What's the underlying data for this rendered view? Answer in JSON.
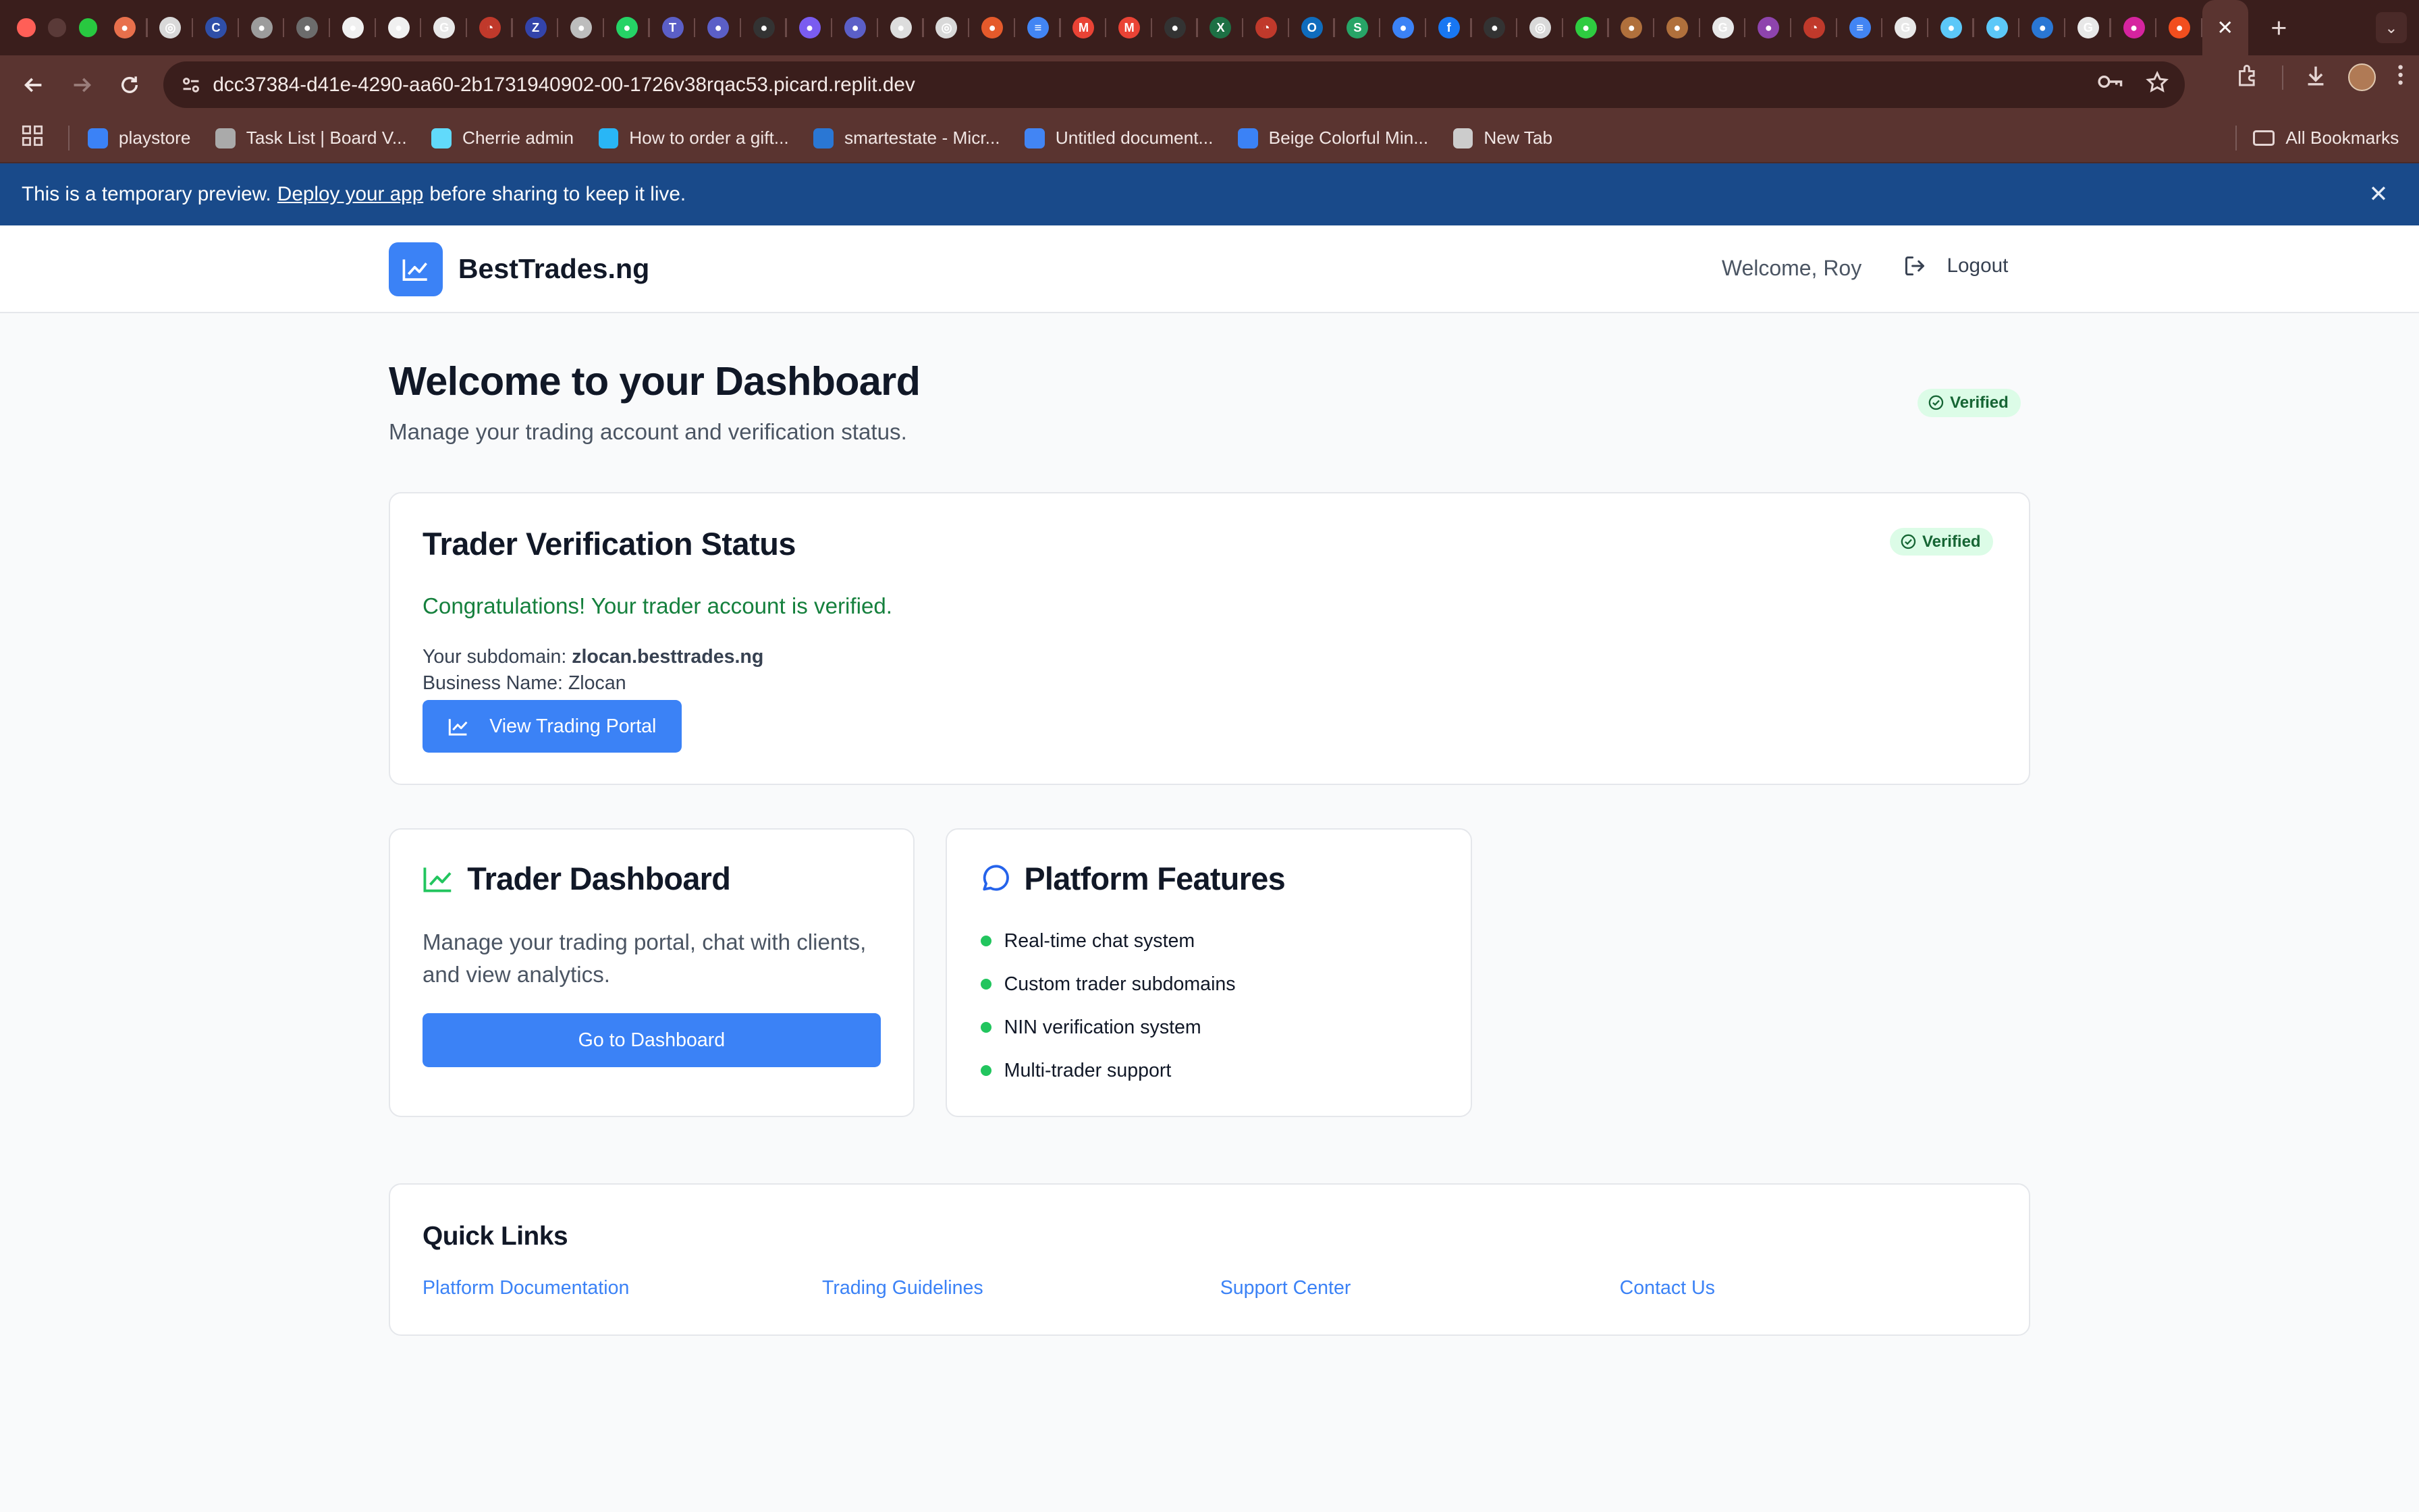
{
  "browser": {
    "url": "dcc37384-d41e-4290-aa60-2b1731940902-00-1726v38rqac53.picard.replit.dev",
    "tab_favicons": [
      {
        "icon": "chrome-icon",
        "color": "#e8704c",
        "glyph": "●"
      },
      {
        "icon": "openai-icon",
        "color": "#d9d9d9",
        "glyph": "◎"
      },
      {
        "icon": "c-icon",
        "color": "#2f4fa8",
        "glyph": "C"
      },
      {
        "icon": "apple-icon",
        "color": "#9c9c9c",
        "glyph": "●"
      },
      {
        "icon": "apple-icon",
        "color": "#6c6c6c",
        "glyph": "●"
      },
      {
        "icon": "github-icon",
        "color": "#f0f0f0",
        "glyph": "●"
      },
      {
        "icon": "github-icon",
        "color": "#f0f0f0",
        "glyph": "●"
      },
      {
        "icon": "google-icon",
        "color": "#e8e8e8",
        "glyph": "G"
      },
      {
        "icon": "speed-icon",
        "color": "#c0392b",
        "glyph": "◔"
      },
      {
        "icon": "z-icon",
        "color": "#3344aa",
        "glyph": "Z"
      },
      {
        "icon": "circle-icon",
        "color": "#bdbdbd",
        "glyph": "●"
      },
      {
        "icon": "whatsapp-icon",
        "color": "#25d366",
        "glyph": "●"
      },
      {
        "icon": "teams-icon",
        "color": "#5b5fc7",
        "glyph": "T"
      },
      {
        "icon": "chat-icon",
        "color": "#5b5fc7",
        "glyph": "●"
      },
      {
        "icon": "3600-icon",
        "color": "#333333",
        "glyph": "●"
      },
      {
        "icon": "messenger-icon",
        "color": "#7a5cf0",
        "glyph": "●"
      },
      {
        "icon": "chat-icon",
        "color": "#5b5fc7",
        "glyph": "●"
      },
      {
        "icon": "globe-icon",
        "color": "#dddddd",
        "glyph": "●"
      },
      {
        "icon": "openai-icon",
        "color": "#d9d9d9",
        "glyph": "◎"
      },
      {
        "icon": "dots-icon",
        "color": "#e55a2b",
        "glyph": "●"
      },
      {
        "icon": "docs-icon",
        "color": "#4285f4",
        "glyph": "≡"
      },
      {
        "icon": "gmail-icon",
        "color": "#ea4335",
        "glyph": "M"
      },
      {
        "icon": "gmail-icon",
        "color": "#ea4335",
        "glyph": "M"
      },
      {
        "icon": "3600-icon",
        "color": "#333333",
        "glyph": "●"
      },
      {
        "icon": "excel-icon",
        "color": "#1d7044",
        "glyph": "X"
      },
      {
        "icon": "speed-icon",
        "color": "#c0392b",
        "glyph": "◔"
      },
      {
        "icon": "outlook-icon",
        "color": "#0f6cbd",
        "glyph": "O"
      },
      {
        "icon": "s-icon",
        "color": "#27a567",
        "glyph": "S"
      },
      {
        "icon": "refresh-icon",
        "color": "#3b82f6",
        "glyph": "●"
      },
      {
        "icon": "facebook-icon",
        "color": "#1877f2",
        "glyph": "f"
      },
      {
        "icon": "3600-icon",
        "color": "#333333",
        "glyph": "●"
      },
      {
        "icon": "openai-icon",
        "color": "#d9d9d9",
        "glyph": "◎"
      },
      {
        "icon": "green-icon",
        "color": "#2ecc40",
        "glyph": "●"
      },
      {
        "icon": "brown-icon",
        "color": "#b0703c",
        "glyph": "●"
      },
      {
        "icon": "brown-icon",
        "color": "#b0703c",
        "glyph": "●"
      },
      {
        "icon": "google-icon",
        "color": "#e8e8e8",
        "glyph": "G"
      },
      {
        "icon": "shield-icon",
        "color": "#8e44ad",
        "glyph": "●"
      },
      {
        "icon": "speed-icon",
        "color": "#c0392b",
        "glyph": "◔"
      },
      {
        "icon": "docs-icon",
        "color": "#4285f4",
        "glyph": "≡"
      },
      {
        "icon": "google-icon",
        "color": "#e8e8e8",
        "glyph": "G"
      },
      {
        "icon": "flutter-icon",
        "color": "#5cc8f8",
        "glyph": "●"
      },
      {
        "icon": "flutter-icon",
        "color": "#5cc8f8",
        "glyph": "●"
      },
      {
        "icon": "azure-icon",
        "color": "#2a77d4",
        "glyph": "●"
      },
      {
        "icon": "google-icon",
        "color": "#e8e8e8",
        "glyph": "G"
      },
      {
        "icon": "instagram-icon",
        "color": "#d6249f",
        "glyph": "●"
      },
      {
        "icon": "figma-icon",
        "color": "#f24e1e",
        "glyph": "●"
      }
    ],
    "active_tab_close": "✕",
    "new_tab": "+",
    "bookmarks": [
      {
        "label": "playstore",
        "color": "#3b82f6"
      },
      {
        "label": "Task List | Board V...",
        "color": "#aaaaaa"
      },
      {
        "label": "Cherrie admin",
        "color": "#61dafb"
      },
      {
        "label": "How to order a gift...",
        "color": "#29b6f6"
      },
      {
        "label": "smartestate - Micr...",
        "color": "#2a77d4"
      },
      {
        "label": "Untitled document...",
        "color": "#4285f4"
      },
      {
        "label": "Beige Colorful Min...",
        "color": "#3b82f6"
      },
      {
        "label": "New Tab",
        "color": "#cccccc"
      }
    ],
    "all_bookmarks": "All Bookmarks"
  },
  "banner": {
    "text_before": "This is a temporary preview.",
    "link": "Deploy your app",
    "text_after": "before sharing to keep it live."
  },
  "header": {
    "brand": "BestTrades.ng",
    "welcome": "Welcome, Roy",
    "logout": "Logout"
  },
  "page": {
    "title": "Welcome to your Dashboard",
    "subtitle": "Manage your trading account and verification status.",
    "status_badge": "Verified"
  },
  "verification": {
    "title": "Trader Verification Status",
    "badge": "Verified",
    "message": "Congratulations! Your trader account is verified.",
    "subdomain_label": "Your subdomain:",
    "subdomain": "zlocan.besttrades.ng",
    "business_name": "Business Name: Zlocan",
    "portal_button": "View Trading Portal"
  },
  "trader_dashboard": {
    "title": "Trader Dashboard",
    "description": "Manage your trading portal, chat with clients, and view analytics.",
    "button": "Go to Dashboard"
  },
  "platform_features": {
    "title": "Platform Features",
    "items": [
      "Real-time chat system",
      "Custom trader subdomains",
      "NIN verification system",
      "Multi-trader support"
    ]
  },
  "quick_links": {
    "title": "Quick Links",
    "links": [
      "Platform Documentation",
      "Trading Guidelines",
      "Support Center",
      "Contact Us"
    ]
  },
  "colors": {
    "primary": "#3b82f6",
    "success": "#15803d",
    "banner": "#194a8a",
    "browser_chrome": "#5a3430"
  }
}
